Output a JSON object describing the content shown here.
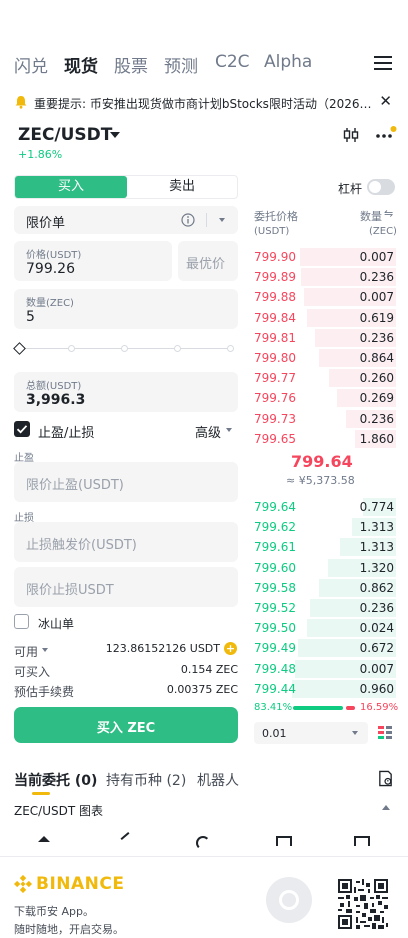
{
  "nav": {
    "tabs": [
      "闪兑",
      "现货",
      "股票",
      "预测",
      "C2C",
      "Alpha"
    ],
    "active_index": 1
  },
  "notice": {
    "text": "重要提示: 币安推出现货做市商计划bStocks限时活动（2026-…"
  },
  "pair": {
    "name": "ZEC/USDT",
    "change": "+1.86%"
  },
  "order": {
    "buy_label": "买入",
    "sell_label": "卖出",
    "leverage_label": "杠杆",
    "type": "限价单",
    "price_label": "价格(USDT)",
    "price_value": "799.26",
    "best_price_label": "最优价",
    "qty_label": "数量(ZEC)",
    "qty_value": "5",
    "total_label": "总额(USDT)",
    "total_value": "3,996.3",
    "tpsl_label": "止盈/止损",
    "advanced_label": "高级",
    "tp_section": "止盈",
    "tp_placeholder": "限价止盈(USDT)",
    "sl_section": "止损",
    "sl_trigger_placeholder": "止损触发价(USDT)",
    "sl_limit_placeholder": "限价止损USDT",
    "iceberg_label": "冰山单",
    "available_label": "可用",
    "available_value": "123.86152126 USDT",
    "can_buy_label": "可买入",
    "can_buy_value": "0.154 ZEC",
    "fee_label": "预估手续费",
    "fee_value": "0.00375 ZEC",
    "submit_label": "买入 ZEC",
    "slider_level": 0
  },
  "orderbook": {
    "price_header": "委托价格",
    "price_unit": "(USDT)",
    "qty_header": "数量",
    "qty_unit": "(ZEC)",
    "asks": [
      {
        "price": "799.90",
        "qty": "0.007",
        "depth": 0.65
      },
      {
        "price": "799.89",
        "qty": "0.236",
        "depth": 0.64
      },
      {
        "price": "799.88",
        "qty": "0.007",
        "depth": 0.62
      },
      {
        "price": "799.84",
        "qty": "0.619",
        "depth": 0.6
      },
      {
        "price": "799.81",
        "qty": "0.236",
        "depth": 0.55
      },
      {
        "price": "799.80",
        "qty": "0.864",
        "depth": 0.52
      },
      {
        "price": "799.77",
        "qty": "0.260",
        "depth": 0.45
      },
      {
        "price": "799.76",
        "qty": "0.269",
        "depth": 0.4
      },
      {
        "price": "799.73",
        "qty": "0.236",
        "depth": 0.34
      },
      {
        "price": "799.65",
        "qty": "1.860",
        "depth": 0.28
      }
    ],
    "last_price": "799.64",
    "last_price_fiat": "≈ ¥5,373.58",
    "bids": [
      {
        "price": "799.64",
        "qty": "0.774",
        "depth": 0.22
      },
      {
        "price": "799.62",
        "qty": "1.313",
        "depth": 0.3
      },
      {
        "price": "799.61",
        "qty": "1.313",
        "depth": 0.38
      },
      {
        "price": "799.60",
        "qty": "1.320",
        "depth": 0.46
      },
      {
        "price": "799.58",
        "qty": "0.862",
        "depth": 0.52
      },
      {
        "price": "799.52",
        "qty": "0.236",
        "depth": 0.58
      },
      {
        "price": "799.50",
        "qty": "0.024",
        "depth": 0.6
      },
      {
        "price": "799.49",
        "qty": "0.672",
        "depth": 0.66
      },
      {
        "price": "799.48",
        "qty": "0.007",
        "depth": 0.68
      },
      {
        "price": "799.44",
        "qty": "0.960",
        "depth": 0.7
      }
    ],
    "buy_pct": "83.41%",
    "sell_pct": "16.59%",
    "buy_ratio": 0.8341,
    "precision": "0.01"
  },
  "bottom": {
    "tabs": [
      "当前委托 (0)",
      "持有币种 (2)",
      "机器人"
    ],
    "chart_label": "ZEC/USDT 图表"
  },
  "footer": {
    "brand": "BINANCE",
    "line1": "下载币安 App。",
    "line2": "随时随地，开启交易。"
  },
  "colors": {
    "buy": "#2ebd85",
    "sell": "#f6465d",
    "brand": "#f0b90b"
  }
}
